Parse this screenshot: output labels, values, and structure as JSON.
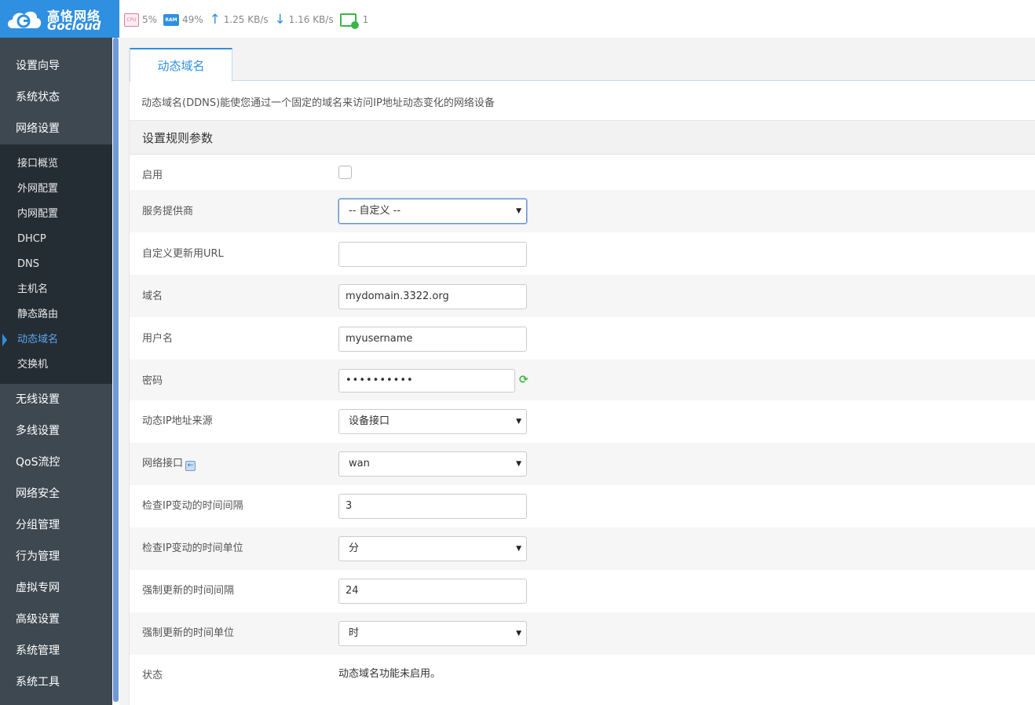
{
  "brand": {
    "name_cn": "高恪网络",
    "name_en": "Gocloud"
  },
  "stats": {
    "cpu_label": "CPU",
    "cpu": "5%",
    "ram_label": "RAM",
    "ram": "49%",
    "upload": "1.25 KB/s",
    "download": "1.16 KB/s",
    "devices": "1"
  },
  "sidebar": {
    "main_top": [
      "设置向导",
      "系统状态",
      "网络设置"
    ],
    "sub_items": [
      "接口概览",
      "外网配置",
      "内网配置",
      "DHCP",
      "DNS",
      "主机名",
      "静态路由",
      "动态域名",
      "交换机"
    ],
    "active_sub": "动态域名",
    "main_bottom": [
      "无线设置",
      "多线设置",
      "QoS流控",
      "网络安全",
      "分组管理",
      "行为管理",
      "虚拟专网",
      "高级设置",
      "系统管理",
      "系统工具"
    ]
  },
  "tab": {
    "label": "动态域名"
  },
  "description": "动态域名(DDNS)能使您通过一个固定的域名来访问IP地址动态变化的网络设备",
  "section_title": "设置规则参数",
  "form": {
    "enable": {
      "label": "启用",
      "checked": false
    },
    "provider": {
      "label": "服务提供商",
      "value": "-- 自定义 --"
    },
    "custom_url": {
      "label": "自定义更新用URL",
      "value": ""
    },
    "domain": {
      "label": "域名",
      "value": "mydomain.3322.org"
    },
    "username": {
      "label": "用户名",
      "value": "myusername"
    },
    "password": {
      "label": "密码",
      "value": "••••••••••"
    },
    "ip_source": {
      "label": "动态IP地址来源",
      "value": "设备接口"
    },
    "interface": {
      "label": "网络接口",
      "value": "wan"
    },
    "check_interval": {
      "label": "检查IP变动的时间间隔",
      "value": "3"
    },
    "check_unit": {
      "label": "检查IP变动的时间单位",
      "value": "分"
    },
    "force_interval": {
      "label": "强制更新的时间间隔",
      "value": "24"
    },
    "force_unit": {
      "label": "强制更新的时间单位",
      "value": "时"
    },
    "status": {
      "label": "状态",
      "value": "动态域名功能未启用。"
    }
  }
}
